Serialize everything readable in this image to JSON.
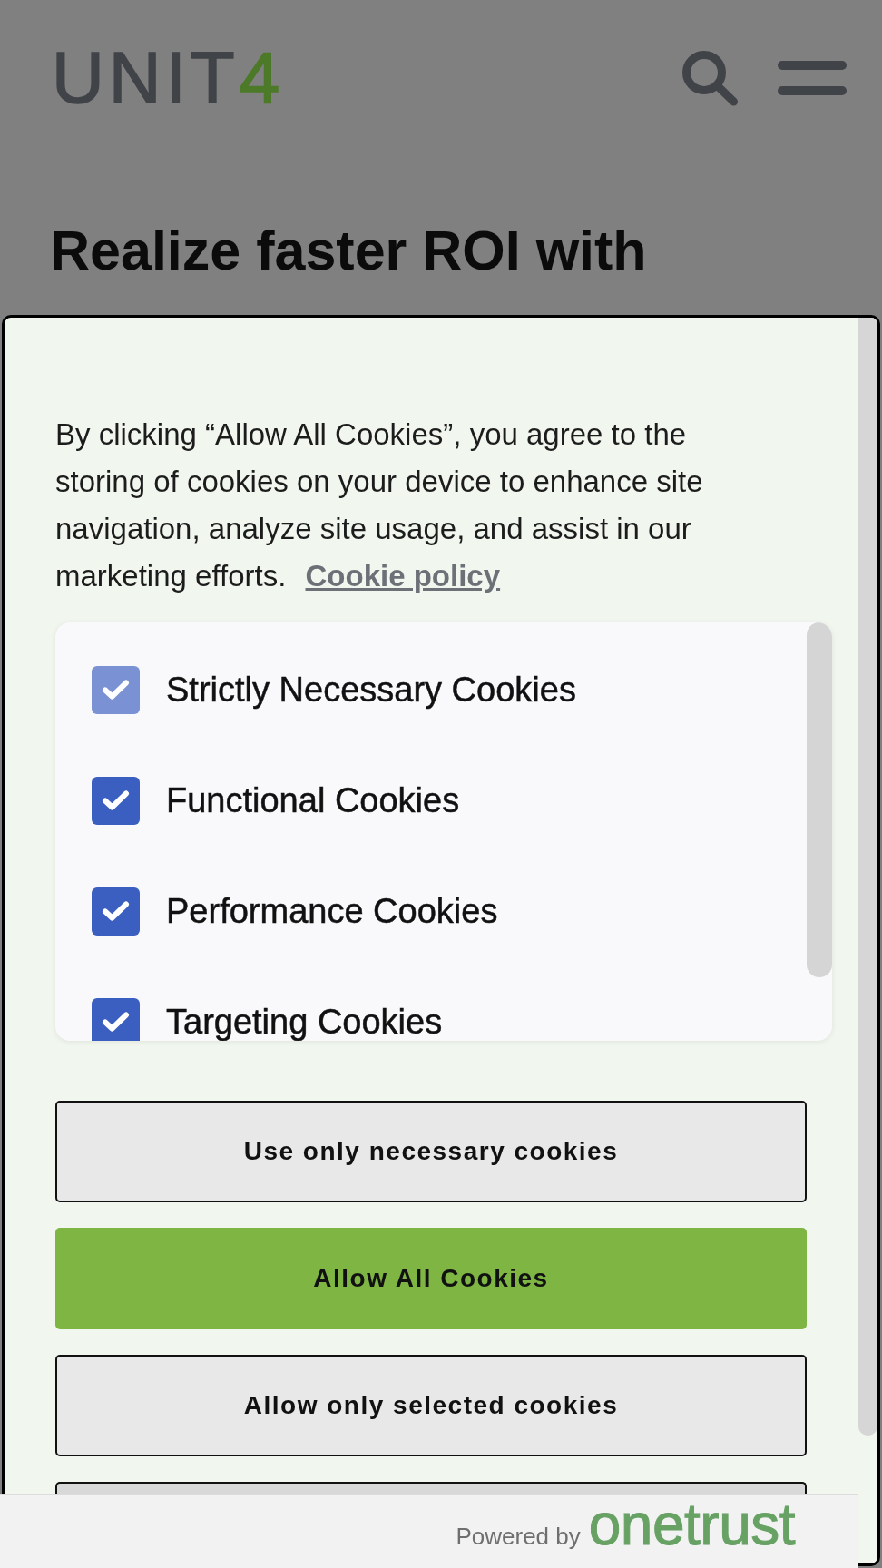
{
  "header": {
    "logo": [
      {
        "text": "UNIT",
        "color": "#404347"
      },
      {
        "text": "4",
        "color": "#4c7a28"
      }
    ]
  },
  "hero": {
    "heading": "Realize faster ROI with"
  },
  "consent": {
    "description": "By clicking “Allow All Cookies”, you agree to the storing of cookies on your device to enhance site navigation, analyze site usage, and assist in our marketing efforts.",
    "policy_link": "Cookie policy",
    "categories": [
      {
        "label": "Strictly Necessary Cookies",
        "checked": true,
        "disabled": true
      },
      {
        "label": "Functional Cookies",
        "checked": true,
        "disabled": false
      },
      {
        "label": "Performance Cookies",
        "checked": true,
        "disabled": false
      },
      {
        "label": "Targeting Cookies",
        "checked": true,
        "disabled": false
      }
    ],
    "buttons": [
      {
        "label": "Use only necessary cookies",
        "kind": "secondary"
      },
      {
        "label": "Allow All Cookies",
        "kind": "primary"
      },
      {
        "label": "Allow only selected cookies",
        "kind": "secondary"
      },
      {
        "kind": "muted"
      }
    ],
    "footer": {
      "powered_by": "Powered by",
      "brand": "onetrust"
    }
  }
}
